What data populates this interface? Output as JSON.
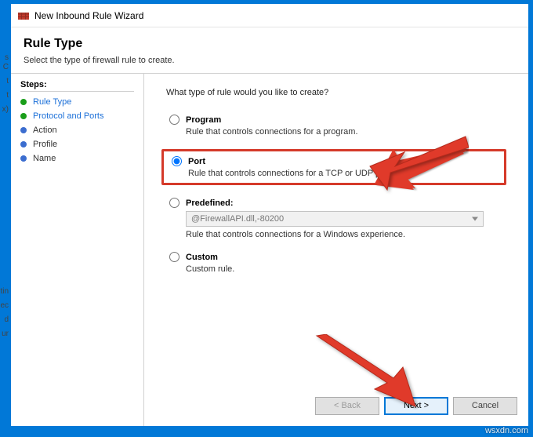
{
  "window_title": "New Inbound Rule Wizard",
  "header": {
    "title": "Rule Type",
    "subtitle": "Select the type of firewall rule to create."
  },
  "steps_label": "Steps:",
  "steps": [
    {
      "label": "Rule Type",
      "color": "green",
      "active": true
    },
    {
      "label": "Protocol and Ports",
      "color": "green",
      "active": true
    },
    {
      "label": "Action",
      "color": "blue",
      "active": false
    },
    {
      "label": "Profile",
      "color": "blue",
      "active": false
    },
    {
      "label": "Name",
      "color": "blue",
      "active": false
    }
  ],
  "prompt": "What type of rule would you like to create?",
  "options": {
    "program": {
      "label": "Program",
      "desc": "Rule that controls connections for a program."
    },
    "port": {
      "label": "Port",
      "desc": "Rule that controls connections for a TCP or UDP port."
    },
    "predef": {
      "label": "Predefined:",
      "value": "@FirewallAPI.dll,-80200",
      "desc": "Rule that controls connections for a Windows experience."
    },
    "custom": {
      "label": "Custom",
      "desc": "Custom rule."
    }
  },
  "buttons": {
    "back": "< Back",
    "next": "Next >",
    "cancel": "Cancel"
  },
  "watermark": "wsxdn.com"
}
